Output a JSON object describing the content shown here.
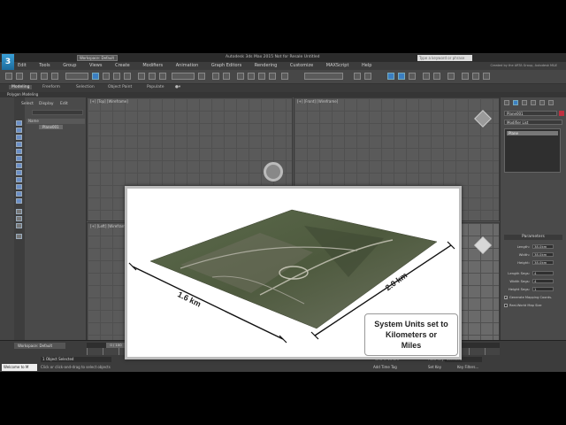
{
  "window": {
    "app_logo": "3",
    "workspace": "Workspace: Default",
    "title": "Autodesk 3ds Max 2015    Not for Resale    Untitled",
    "search_placeholder": "Type a keyword or phrase",
    "copyright": "Created by the ARTA Group, Autodesk M&E"
  },
  "menu": [
    "Edit",
    "Tools",
    "Group",
    "Views",
    "Create",
    "Modifiers",
    "Animation",
    "Graph Editors",
    "Rendering",
    "Customize",
    "MAXScript",
    "Help"
  ],
  "ribbon": {
    "tabs": [
      "Modeling",
      "Freeform",
      "Selection",
      "Object Paint",
      "Populate"
    ],
    "sub_label": "Polygon Modeling"
  },
  "scene_explorer": {
    "tabs": [
      "Select",
      "Display",
      "Edit"
    ],
    "column_header": "Name",
    "items": [
      "Plane001"
    ]
  },
  "viewports": {
    "top_label": "[+] [Top] [Wireframe]",
    "front_label": "[+] [Front] [Wireframe]",
    "left_label": "[+] [Left] [Wireframe]"
  },
  "command_panel": {
    "object_name": "Plane001",
    "object_color": "#c03040",
    "modifier_list": "Modifier List",
    "stack": [
      "Plane"
    ],
    "rollout_title": "Parameters",
    "params": [
      {
        "label": "Length:",
        "value": "38.0km"
      },
      {
        "label": "Width:",
        "value": "38.0km"
      },
      {
        "label": "Height:",
        "value": "38.0km"
      },
      {
        "label": "Length Segs:",
        "value": "4"
      },
      {
        "label": "Width Segs:",
        "value": "4"
      },
      {
        "label": "Height Segs:",
        "value": "1"
      }
    ],
    "checkboxes": [
      {
        "label": "Generate Mapping Coords.",
        "checked": true
      },
      {
        "label": "Real-World Map Size",
        "checked": false
      }
    ]
  },
  "overlay": {
    "dim_left": "1.6 km",
    "dim_right": "2.0 km",
    "callout_lines": [
      "System Units set to",
      "Kilometers or",
      "Miles"
    ]
  },
  "bottom": {
    "workspace": "Workspace: Default",
    "frame_counter": "0 / 100",
    "status_selected": "1 Object Selected",
    "status_hint": "Click or click-and-drag to select objects",
    "maxscript_text": "Welcome to M",
    "grid": "Grid = 10.0m",
    "auto_key": "Auto Key",
    "selection_set": "Selected",
    "set_key": "Set Key",
    "key_filters": "Key Filters...",
    "add_time_tag": "Add Time Tag"
  }
}
